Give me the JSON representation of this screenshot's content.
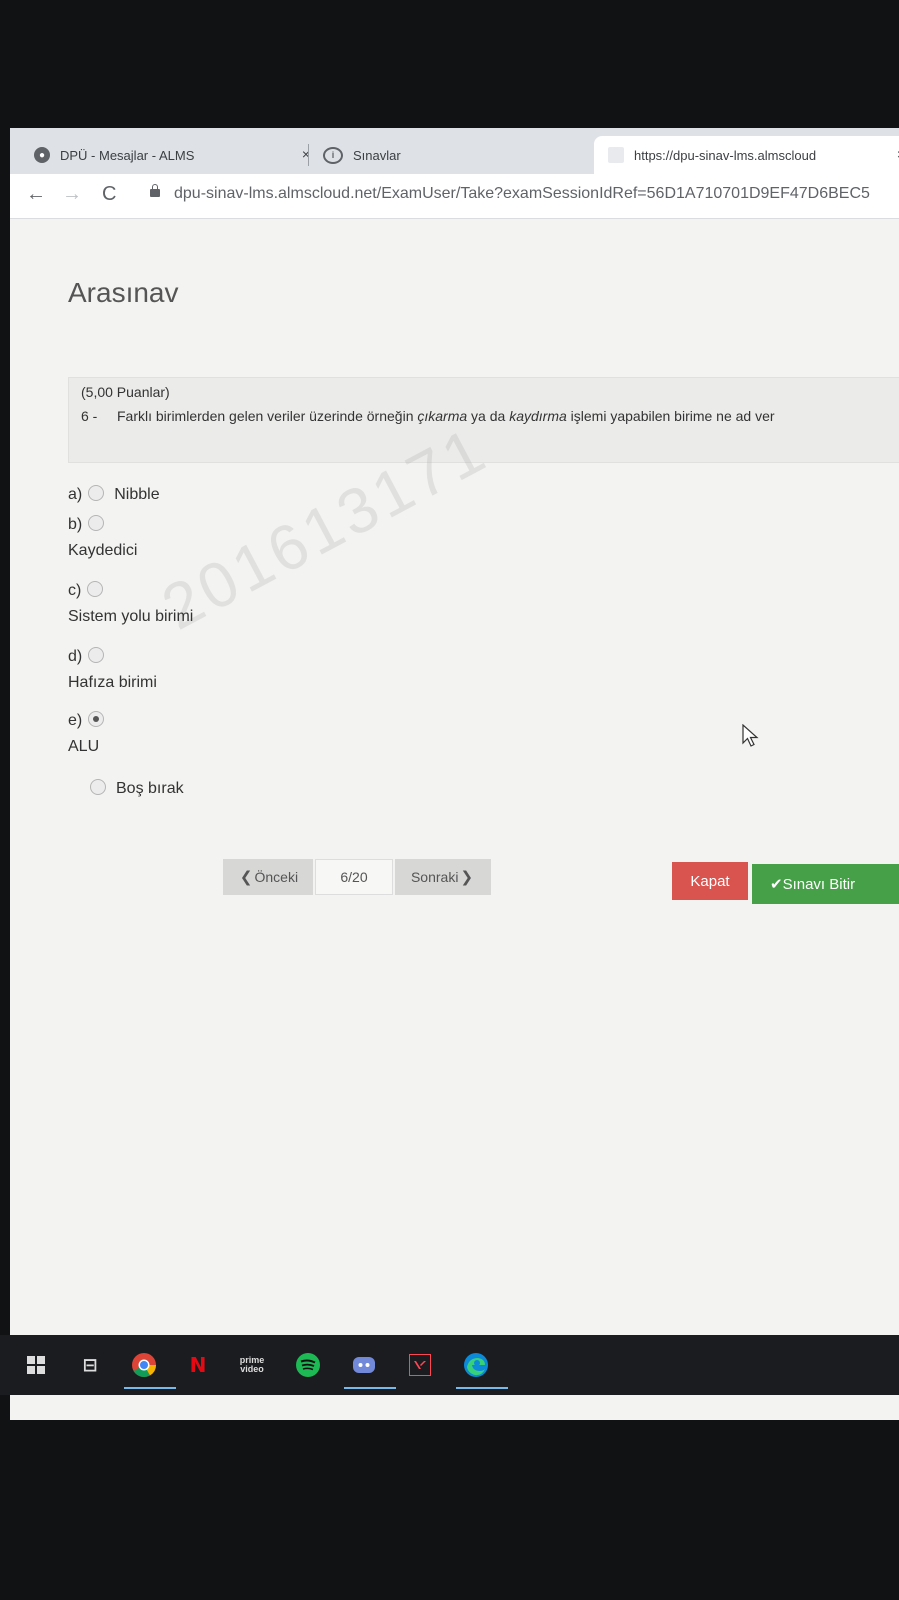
{
  "browser": {
    "tabs": [
      {
        "label": "DPÜ - Mesajlar - ALMS",
        "close": "×"
      },
      {
        "label": "Sınavlar",
        "close": "×"
      },
      {
        "label": "https://dpu-sinav-lms.almscloud",
        "close": "×"
      }
    ],
    "nav": {
      "back": "←",
      "forward": "→",
      "reload": "C"
    },
    "url": "dpu-sinav-lms.almscloud.net/ExamUser/Take?examSessionIdRef=56D1A710701D9EF47D6BEC5"
  },
  "exam": {
    "title": "Arasınav",
    "watermark": "201613171",
    "question": {
      "points": "(5,00 Puanlar)",
      "number": "6 -",
      "text_before": "Farklı birimlerden gelen veriler üzerinde örneğin ",
      "em1": "çıkarma",
      "text_mid": " ya da ",
      "em2": "kaydırma",
      "text_after": " işlemi yapabilen birime ne ad ver"
    },
    "options": [
      {
        "letter": "a)",
        "text": "Nibble",
        "selected": false
      },
      {
        "letter": "b)",
        "text": "Kaydedici",
        "selected": false
      },
      {
        "letter": "c)",
        "text": "Sistem yolu birimi",
        "selected": false
      },
      {
        "letter": "d)",
        "text": "Hafıza birimi",
        "selected": false
      },
      {
        "letter": "e)",
        "text": "ALU",
        "selected": true
      }
    ],
    "skip_label": "Boş bırak"
  },
  "navigation": {
    "prev_label": "Önceki",
    "prev_chevron": "❮",
    "page_indicator": "6/20",
    "next_label": "Sonraki",
    "next_chevron": "❯",
    "close_label": "Kapat",
    "finish_check": "✔",
    "finish_label": "Sınavı Bitir"
  },
  "taskbar": {
    "netflix": "N",
    "prime_line1": "prime",
    "prime_line2": "video",
    "taskview": "⊟"
  },
  "colors": {
    "close_button": "#d9534f",
    "finish_button": "#45a047",
    "page_background": "#f3f3f1"
  }
}
